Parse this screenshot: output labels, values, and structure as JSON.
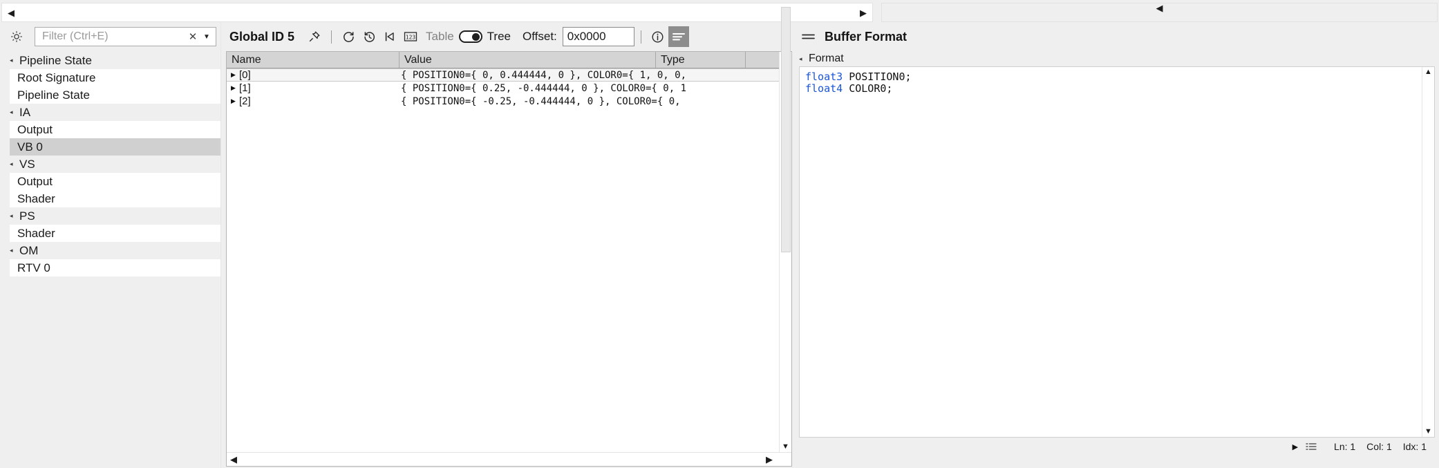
{
  "top_scrollbars": {
    "left": {
      "left_arrow": "◀",
      "right_arrow": "▶"
    },
    "right": {
      "left_arrow": "◀"
    }
  },
  "sidebar": {
    "gear_icon": "gear-icon",
    "filter": {
      "placeholder": "Filter (Ctrl+E)",
      "value": "",
      "clear_glyph": "✕",
      "dropdown_glyph": "▼"
    },
    "collapse_glyph": "◂",
    "groups": [
      {
        "label": "Pipeline State",
        "items": [
          {
            "label": "Root Signature",
            "selected": false
          },
          {
            "label": "Pipeline State",
            "selected": false
          }
        ]
      },
      {
        "label": "IA",
        "items": [
          {
            "label": "Output",
            "selected": false
          },
          {
            "label": "VB 0",
            "selected": true
          }
        ]
      },
      {
        "label": "VS",
        "items": [
          {
            "label": "Output",
            "selected": false
          },
          {
            "label": "Shader",
            "selected": false
          }
        ]
      },
      {
        "label": "PS",
        "items": [
          {
            "label": "Shader",
            "selected": false
          }
        ]
      },
      {
        "label": "OM",
        "items": [
          {
            "label": "RTV 0",
            "selected": false
          }
        ]
      }
    ]
  },
  "center": {
    "toolbar": {
      "title": "Global ID 5",
      "pin_icon": "pin-icon",
      "refresh_icon": "refresh-icon",
      "history_icon": "history-icon",
      "step_back_icon": "step-back-icon",
      "numeric_icon": "numeric-123-icon",
      "table_label": "Table",
      "tree_label": "Tree",
      "view_mode": "Tree",
      "offset_label": "Offset:",
      "offset_value": "0x0000",
      "info_icon": "info-icon",
      "format_lines_icon": "format-lines-icon",
      "format_lines_active": true
    },
    "grid": {
      "columns": [
        "Name",
        "Value",
        "Type",
        ""
      ],
      "rows": [
        {
          "expand_glyph": "▶",
          "name": "[0]",
          "value": "{ POSITION0={ 0, 0.444444, 0 }, COLOR0={ 1, 0, 0,",
          "type": "",
          "selected": true
        },
        {
          "expand_glyph": "▶",
          "name": "[1]",
          "value": "{ POSITION0={ 0.25, -0.444444, 0 }, COLOR0={ 0, 1",
          "type": "",
          "selected": false
        },
        {
          "expand_glyph": "▶",
          "name": "[2]",
          "value": "{ POSITION0={ -0.25, -0.444444, 0 }, COLOR0={ 0,",
          "type": "",
          "selected": false
        }
      ],
      "vscroll": {
        "up_arrow": "▲",
        "down_arrow": "▼"
      },
      "hscroll": {
        "left_arrow": "◀",
        "right_arrow": "▶"
      }
    }
  },
  "right": {
    "panel_icon": "menu-lines-icon",
    "title": "Buffer Format",
    "format_section": {
      "collapse_glyph": "◂",
      "label": "Format"
    },
    "code": [
      {
        "keyword": "float3",
        "rest": " POSITION0;"
      },
      {
        "keyword": "float4",
        "rest": " COLOR0;"
      }
    ],
    "vscroll": {
      "up_arrow": "▲",
      "down_arrow": "▼"
    },
    "status": {
      "expand_glyph": "▶",
      "list_icon": "list-icon",
      "line": "Ln: 1",
      "col": "Col: 1",
      "idx": "Idx: 1"
    }
  },
  "colors": {
    "chrome": "#efefef",
    "selection": "#d0d0d0",
    "header": "#d4d4d4",
    "keyword": "#1b55d6",
    "active_button": "#8d8d8d"
  }
}
